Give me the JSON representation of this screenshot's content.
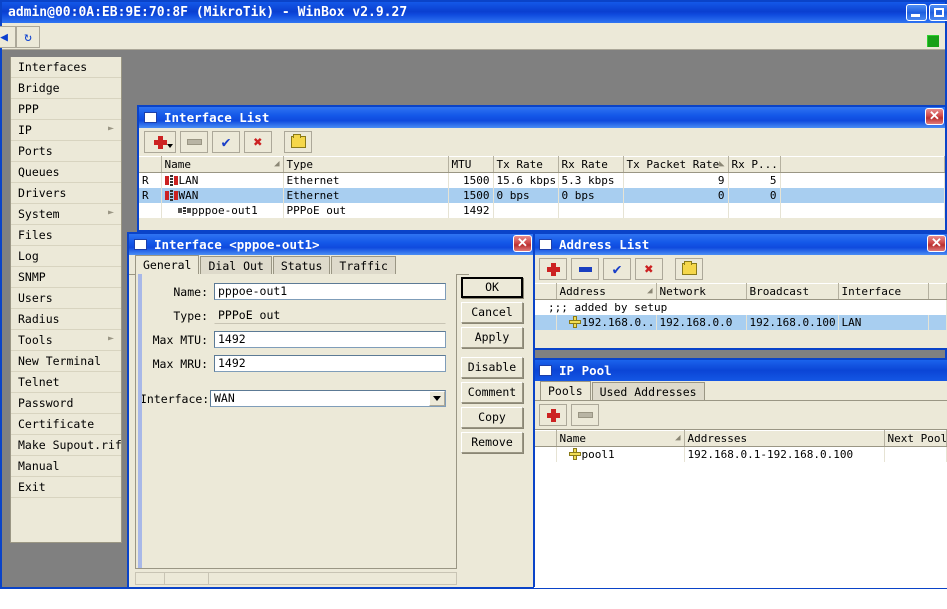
{
  "app": {
    "title": "admin@00:0A:EB:9E:70:8F (MikroTik) - WinBox v2.9.27",
    "minimize_label": "",
    "maximize_label": "",
    "toolbar": {
      "back_glyph": "◀",
      "refresh_glyph": "↻"
    },
    "status_led": "connected-green"
  },
  "sidebar": {
    "items": [
      {
        "label": "Interfaces",
        "submenu": false
      },
      {
        "label": "Bridge",
        "submenu": false
      },
      {
        "label": "PPP",
        "submenu": false
      },
      {
        "label": "IP",
        "submenu": true
      },
      {
        "label": "Ports",
        "submenu": false
      },
      {
        "label": "Queues",
        "submenu": false
      },
      {
        "label": "Drivers",
        "submenu": false
      },
      {
        "label": "System",
        "submenu": true
      },
      {
        "label": "Files",
        "submenu": false
      },
      {
        "label": "Log",
        "submenu": false
      },
      {
        "label": "SNMP",
        "submenu": false
      },
      {
        "label": "Users",
        "submenu": false
      },
      {
        "label": "Radius",
        "submenu": false
      },
      {
        "label": "Tools",
        "submenu": true
      },
      {
        "label": "New Terminal",
        "submenu": false
      },
      {
        "label": "Telnet",
        "submenu": false
      },
      {
        "label": "Password",
        "submenu": false
      },
      {
        "label": "Certificate",
        "submenu": false
      },
      {
        "label": "Make Supout.rif",
        "submenu": false
      },
      {
        "label": "Manual",
        "submenu": false
      },
      {
        "label": "Exit",
        "submenu": false
      }
    ]
  },
  "interface_list": {
    "title": "Interface List",
    "close_label": "✕",
    "toolbar": [
      {
        "name": "add",
        "icon": "plus-icon",
        "dropdown": true
      },
      {
        "name": "remove",
        "icon": "minus-icon",
        "disabled": true
      },
      {
        "name": "enable",
        "icon": "check-icon"
      },
      {
        "name": "disable",
        "icon": "x-icon"
      },
      {
        "name": "comment",
        "icon": "folder-icon"
      }
    ],
    "columns": [
      "",
      "Name",
      "Type",
      "MTU",
      "Tx Rate",
      "Rx Rate",
      "Tx Packet Rate",
      "Rx P...",
      ""
    ],
    "sorted_column": "Tx Packet Rate",
    "rows": [
      {
        "flag": "R",
        "name": "LAN",
        "icon": "interface-icon",
        "type": "Ethernet",
        "mtu": "1500",
        "tx_rate": "15.6 kbps",
        "rx_rate": "5.3 kbps",
        "tx_packet_rate": "9",
        "rx_packet_rate": "5",
        "selected": false
      },
      {
        "flag": "R",
        "name": "WAN",
        "icon": "interface-icon",
        "type": "Ethernet",
        "mtu": "1500",
        "tx_rate": "0 bps",
        "rx_rate": "0 bps",
        "tx_packet_rate": "0",
        "rx_packet_rate": "0",
        "selected": true
      },
      {
        "flag": "",
        "name": "pppoe-out1",
        "icon": "pppoe-icon",
        "type": "PPPoE out",
        "mtu": "1492",
        "tx_rate": "",
        "rx_rate": "",
        "tx_packet_rate": "",
        "rx_packet_rate": "",
        "selected": false
      }
    ]
  },
  "pppoe_dialog": {
    "title": "Interface <pppoe-out1>",
    "close_label": "✕",
    "tabs": [
      {
        "label": "General",
        "active": true
      },
      {
        "label": "Dial Out",
        "active": false
      },
      {
        "label": "Status",
        "active": false
      },
      {
        "label": "Traffic",
        "active": false
      }
    ],
    "fields": [
      {
        "label": "Name:",
        "value": "pppoe-out1",
        "kind": "text"
      },
      {
        "label": "Type:",
        "value": "PPPoE out",
        "kind": "readonly"
      },
      {
        "label": "Max MTU:",
        "value": "1492",
        "kind": "text"
      },
      {
        "label": "Max MRU:",
        "value": "1492",
        "kind": "text"
      }
    ],
    "interface_field": {
      "label": "Interface:",
      "value": "WAN",
      "kind": "combo"
    },
    "buttons": [
      {
        "label": "OK",
        "default": true
      },
      {
        "label": "Cancel",
        "default": false
      },
      {
        "label": "Apply",
        "default": false
      },
      {
        "label": "Disable",
        "default": false,
        "gap": true
      },
      {
        "label": "Comment",
        "default": false
      },
      {
        "label": "Copy",
        "default": false
      },
      {
        "label": "Remove",
        "default": false
      }
    ]
  },
  "address_list": {
    "title": "Address List",
    "close_label": "✕",
    "toolbar": [
      {
        "name": "add",
        "icon": "plus-icon"
      },
      {
        "name": "remove",
        "icon": "minus-icon"
      },
      {
        "name": "enable",
        "icon": "check-icon"
      },
      {
        "name": "disable",
        "icon": "x-icon"
      },
      {
        "name": "comment",
        "icon": "folder-icon"
      }
    ],
    "columns": [
      "",
      "Address",
      "Network",
      "Broadcast",
      "Interface",
      ""
    ],
    "sorted_column": "Address",
    "comment_row": ";;; added by setup",
    "rows": [
      {
        "address": "192.168.0....",
        "network": "192.168.0.0",
        "broadcast": "192.168.0.100",
        "interface": "LAN",
        "icon": "address-icon",
        "selected": true
      }
    ]
  },
  "ip_pool": {
    "title": "IP Pool",
    "tabs": [
      {
        "label": "Pools",
        "active": true
      },
      {
        "label": "Used Addresses",
        "active": false
      }
    ],
    "toolbar": [
      {
        "name": "add",
        "icon": "plus-icon"
      },
      {
        "name": "remove",
        "icon": "minus-icon",
        "disabled": true
      }
    ],
    "columns": [
      "",
      "Name",
      "Addresses",
      "Next Pool"
    ],
    "sorted_column": "Name",
    "rows": [
      {
        "name": "pool1",
        "addresses": "192.168.0.1-192.168.0.100",
        "next_pool": "",
        "icon": "pool-icon",
        "selected": false
      }
    ]
  },
  "colors": {
    "titlebar_blue": "#0a3fd0",
    "window_face": "#ece9d8",
    "desktop_gray": "#808080",
    "selection_blue": "#a8cef0",
    "accent_red": "#cc2222",
    "accent_yellow": "#f2dd55",
    "status_green": "#18a018"
  }
}
